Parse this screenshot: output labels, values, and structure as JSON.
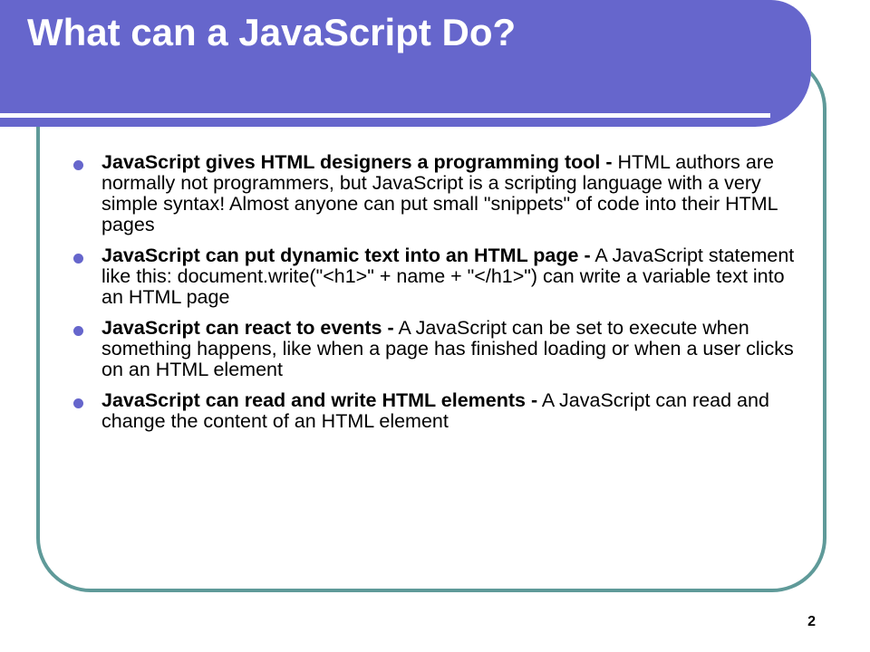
{
  "slide": {
    "title": "What can a JavaScript Do?",
    "page_number": "2",
    "colors": {
      "header": "#6666cc",
      "frame": "#5f9a99",
      "bullet": "#6666cc",
      "title_text": "#ffffff",
      "body_text": "#000000"
    }
  },
  "bullets": [
    {
      "head": "JavaScript gives HTML designers a programming tool -",
      "body": " HTML authors are normally not programmers, but JavaScript is a scripting language with a very simple syntax! Almost anyone can put small \"snippets\" of code into their HTML pages"
    },
    {
      "head": "JavaScript can put dynamic text into an HTML page -",
      "body": " A JavaScript statement like this: document.write(\"<h1>\" + name + \"</h1>\") can write a variable text into an HTML page"
    },
    {
      "head": "JavaScript can react to events -",
      "body": " A JavaScript can be set to execute when something happens, like when a page has finished loading or when a user clicks on an HTML element"
    },
    {
      "head": "JavaScript can read and write HTML elements -",
      "body": " A JavaScript can read and change the content of an HTML element"
    }
  ]
}
